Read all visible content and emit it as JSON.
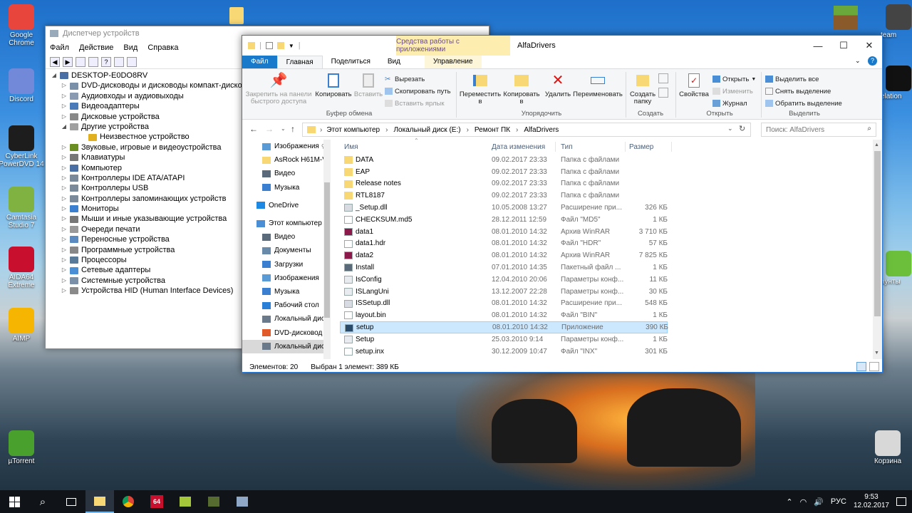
{
  "desktop": {
    "icons_left": [
      {
        "label": "Google Chrome",
        "icon": "chrome-icon",
        "color": "#e8453c"
      },
      {
        "label": "Discord",
        "icon": "discord-icon",
        "color": "#7289da"
      },
      {
        "label": "CyberLink PowerDVD 14",
        "icon": "powerdvd-icon",
        "color": "#1d1d1d"
      },
      {
        "label": "Camtasia Studio 7",
        "icon": "camtasia-icon",
        "color": "#7fb241"
      },
      {
        "label": "AIDA64 Extreme",
        "icon": "aida64-icon",
        "color": "#c8102e"
      },
      {
        "label": "AIMP",
        "icon": "aimp-icon",
        "color": "#f6b500"
      },
      {
        "label": "µTorrent",
        "icon": "utorrent-icon",
        "color": "#4aa02c"
      }
    ],
    "icons_right": [
      {
        "label": "team",
        "icon": "steam-icon"
      },
      {
        "label": "elation",
        "icon": "revelation-icon"
      },
      {
        "label": "аунты",
        "icon": "accounts-icon"
      },
      {
        "label": "Корзина",
        "icon": "recycle-bin-icon"
      }
    ]
  },
  "device_manager": {
    "title": "Диспетчер устройств",
    "menu": [
      "Файл",
      "Действие",
      "Вид",
      "Справка"
    ],
    "root": "DESKTOP-E0DO8RV",
    "nodes": [
      {
        "label": "DVD-дисководы и дисководы компакт-дисков",
        "expanded": false,
        "child": false
      },
      {
        "label": "Аудиовходы и аудиовыходы",
        "expanded": false,
        "child": false
      },
      {
        "label": "Видеоадаптеры",
        "expanded": false,
        "child": false
      },
      {
        "label": "Дисковые устройства",
        "expanded": false,
        "child": false
      },
      {
        "label": "Другие устройства",
        "expanded": true,
        "child": false
      },
      {
        "label": "Неизвестное устройство",
        "expanded": false,
        "child": true
      },
      {
        "label": "Звуковые, игровые и видеоустройства",
        "expanded": false,
        "child": false
      },
      {
        "label": "Клавиатуры",
        "expanded": false,
        "child": false
      },
      {
        "label": "Компьютер",
        "expanded": false,
        "child": false
      },
      {
        "label": "Контроллеры IDE ATA/ATAPI",
        "expanded": false,
        "child": false
      },
      {
        "label": "Контроллеры USB",
        "expanded": false,
        "child": false
      },
      {
        "label": "Контроллеры запоминающих устройств",
        "expanded": false,
        "child": false
      },
      {
        "label": "Мониторы",
        "expanded": false,
        "child": false
      },
      {
        "label": "Мыши и иные указывающие устройства",
        "expanded": false,
        "child": false
      },
      {
        "label": "Очереди печати",
        "expanded": false,
        "child": false
      },
      {
        "label": "Переносные устройства",
        "expanded": false,
        "child": false
      },
      {
        "label": "Программные устройства",
        "expanded": false,
        "child": false
      },
      {
        "label": "Процессоры",
        "expanded": false,
        "child": false
      },
      {
        "label": "Сетевые адаптеры",
        "expanded": false,
        "child": false
      },
      {
        "label": "Системные устройства",
        "expanded": false,
        "child": false
      },
      {
        "label": "Устройства HID (Human Interface Devices)",
        "expanded": false,
        "child": false
      }
    ]
  },
  "explorer": {
    "title": "AlfaDrivers",
    "context_tab_title": "Средства работы с приложениями",
    "tabs": {
      "file": "Файл",
      "home": "Главная",
      "share": "Поделиться",
      "view": "Вид",
      "manage": "Управление"
    },
    "ribbon": {
      "pin": "Закрепить на панели быстрого доступа",
      "copy": "Копировать",
      "paste": "Вставить",
      "cut": "Вырезать",
      "copy_path": "Скопировать путь",
      "paste_shortcut": "Вставить ярлык",
      "clipboard_group": "Буфер обмена",
      "move_to": "Переместить в",
      "copy_to": "Копировать в",
      "delete": "Удалить",
      "rename": "Переименовать",
      "organize_group": "Упорядочить",
      "new_folder": "Создать папку",
      "create_group": "Создать",
      "properties": "Свойства",
      "open": "Открыть",
      "edit": "Изменить",
      "history": "Журнал",
      "open_group": "Открыть",
      "select_all": "Выделить все",
      "select_none": "Снять выделение",
      "invert_selection": "Обратить выделение",
      "select_group": "Выделить"
    },
    "breadcrumb": [
      "Этот компьютер",
      "Локальный диск (E:)",
      "Ремонт ПК",
      "AlfaDrivers"
    ],
    "search_placeholder": "Поиск: AlfaDrivers",
    "nav": [
      {
        "label": "Изображения",
        "indent": 1,
        "icon": "pictures-icon",
        "pinned": true
      },
      {
        "label": "AsRock H61M-V",
        "indent": 1,
        "icon": "folder-icon"
      },
      {
        "label": "Видео",
        "indent": 1,
        "icon": "video-icon"
      },
      {
        "label": "Музыка",
        "indent": 1,
        "icon": "music-icon"
      },
      {
        "label": "",
        "indent": 0,
        "icon": "",
        "spacer": true
      },
      {
        "label": "OneDrive",
        "indent": 0,
        "icon": "onedrive-icon"
      },
      {
        "label": "",
        "indent": 0,
        "icon": "",
        "spacer": true
      },
      {
        "label": "Этот компьютер",
        "indent": 0,
        "icon": "this-pc-icon"
      },
      {
        "label": "Видео",
        "indent": 1,
        "icon": "video-icon"
      },
      {
        "label": "Документы",
        "indent": 1,
        "icon": "documents-icon"
      },
      {
        "label": "Загрузки",
        "indent": 1,
        "icon": "downloads-icon"
      },
      {
        "label": "Изображения",
        "indent": 1,
        "icon": "pictures-icon"
      },
      {
        "label": "Музыка",
        "indent": 1,
        "icon": "music-icon"
      },
      {
        "label": "Рабочий стол",
        "indent": 1,
        "icon": "desktop-icon"
      },
      {
        "label": "Локальный дис",
        "indent": 1,
        "icon": "drive-icon"
      },
      {
        "label": "DVD-дисковод (",
        "indent": 1,
        "icon": "dvd-icon"
      },
      {
        "label": "Локальный дис",
        "indent": 1,
        "icon": "drive-icon",
        "selected": true
      }
    ],
    "columns": {
      "name": "Имя",
      "date": "Дата изменения",
      "type": "Тип",
      "size": "Размер"
    },
    "files": [
      {
        "name": "DATA",
        "date": "09.02.2017 23:33",
        "type": "Папка с файлами",
        "size": "",
        "icon": "folder-icon"
      },
      {
        "name": "EAP",
        "date": "09.02.2017 23:33",
        "type": "Папка с файлами",
        "size": "",
        "icon": "folder-icon"
      },
      {
        "name": "Release notes",
        "date": "09.02.2017 23:33",
        "type": "Папка с файлами",
        "size": "",
        "icon": "folder-icon"
      },
      {
        "name": "RTL8187",
        "date": "09.02.2017 23:33",
        "type": "Папка с файлами",
        "size": "",
        "icon": "folder-icon"
      },
      {
        "name": "_Setup.dll",
        "date": "10.05.2008 13:27",
        "type": "Расширение при...",
        "size": "326 КБ",
        "icon": "dll-icon"
      },
      {
        "name": "CHECKSUM.md5",
        "date": "28.12.2011 12:59",
        "type": "Файл \"MD5\"",
        "size": "1 КБ",
        "icon": "file-icon"
      },
      {
        "name": "data1",
        "date": "08.01.2010 14:32",
        "type": "Архив WinRAR",
        "size": "3 710 КБ",
        "icon": "winrar-icon"
      },
      {
        "name": "data1.hdr",
        "date": "08.01.2010 14:32",
        "type": "Файл \"HDR\"",
        "size": "57 КБ",
        "icon": "file-icon"
      },
      {
        "name": "data2",
        "date": "08.01.2010 14:32",
        "type": "Архив WinRAR",
        "size": "7 825 КБ",
        "icon": "winrar-icon"
      },
      {
        "name": "Install",
        "date": "07.01.2010 14:35",
        "type": "Пакетный файл ...",
        "size": "1 КБ",
        "icon": "batch-icon"
      },
      {
        "name": "IsConfig",
        "date": "12.04.2010 20:06",
        "type": "Параметры конф...",
        "size": "11 КБ",
        "icon": "config-icon"
      },
      {
        "name": "ISLangUni",
        "date": "13.12.2007 22:28",
        "type": "Параметры конф...",
        "size": "30 КБ",
        "icon": "config-icon"
      },
      {
        "name": "ISSetup.dll",
        "date": "08.01.2010 14:32",
        "type": "Расширение при...",
        "size": "548 КБ",
        "icon": "dll-icon"
      },
      {
        "name": "layout.bin",
        "date": "08.01.2010 14:32",
        "type": "Файл \"BIN\"",
        "size": "1 КБ",
        "icon": "file-icon"
      },
      {
        "name": "setup",
        "date": "08.01.2010 14:32",
        "type": "Приложение",
        "size": "390 КБ",
        "icon": "setup-app-icon",
        "selected": true
      },
      {
        "name": "Setup",
        "date": "25.03.2010 9:14",
        "type": "Параметры конф...",
        "size": "1 КБ",
        "icon": "config-icon"
      },
      {
        "name": "setup.inx",
        "date": "30.12.2009 10:47",
        "type": "Файл \"INX\"",
        "size": "301 КБ",
        "icon": "file-icon"
      }
    ],
    "status": {
      "count": "Элементов: 20",
      "selection": "Выбран 1 элемент: 389 КБ"
    }
  },
  "taskbar": {
    "language": "РУС",
    "time": "9:53",
    "date": "12.02.2017"
  },
  "colors": {
    "accent": "#2b7bd6",
    "selection": "#cce8ff",
    "taskbar": "#101418",
    "folder": "#f8d775"
  }
}
